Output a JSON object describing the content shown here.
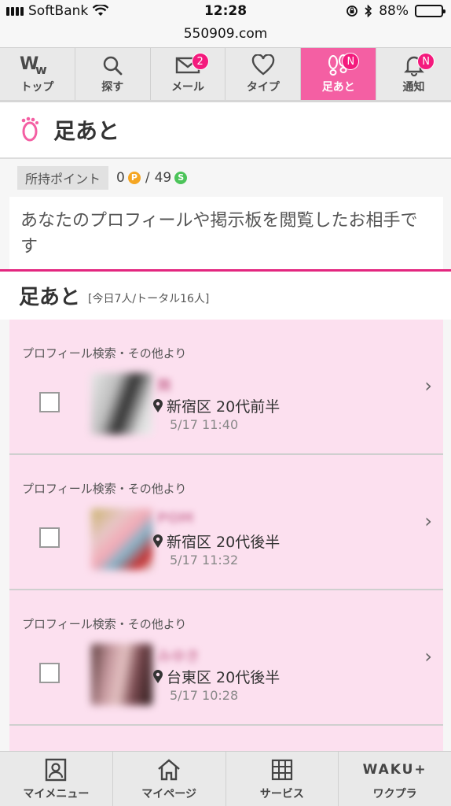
{
  "status_bar": {
    "carrier": "SoftBank",
    "time": "12:28",
    "battery": "88%",
    "battery_level": 0.88
  },
  "browser": {
    "url": "550909.com"
  },
  "nav_tabs": [
    {
      "label": "トップ",
      "icon": "ww-logo-icon",
      "badge": ""
    },
    {
      "label": "探す",
      "icon": "search-icon",
      "badge": ""
    },
    {
      "label": "メール",
      "icon": "mail-icon",
      "badge": "2"
    },
    {
      "label": "タイプ",
      "icon": "heart-icon",
      "badge": ""
    },
    {
      "label": "足あと",
      "icon": "footprint-icon",
      "badge": "N",
      "active": true
    },
    {
      "label": "通知",
      "icon": "bell-icon",
      "badge": "N"
    }
  ],
  "page": {
    "title": "足あと",
    "points_label": "所持ポイント",
    "points_p": "0",
    "points_sep": "/",
    "points_s": "49",
    "description": "あなたのプロフィールや掲示板を閲覧したお相手です"
  },
  "section": {
    "title": "足あと",
    "subtitle": "[今日7人/トータル16人]"
  },
  "visitors": [
    {
      "source": "プロフィール検索・その他より",
      "name": "舞",
      "area": "新宿区 20代前半",
      "datetime": "5/17 11:40"
    },
    {
      "source": "プロフィール検索・その他より",
      "name": "POM",
      "area": "新宿区 20代後半",
      "datetime": "5/17 11:32"
    },
    {
      "source": "プロフィール検索・その他より",
      "name": "みゆき",
      "area": "台東区 20代後半",
      "datetime": "5/17 10:28"
    }
  ],
  "bottom_tabs": [
    {
      "label": "マイメニュー",
      "icon": "person-card-icon"
    },
    {
      "label": "マイページ",
      "icon": "home-icon"
    },
    {
      "label": "サービス",
      "icon": "grid-icon"
    },
    {
      "label": "ワクプラ",
      "icon_text": "WAKU+",
      "icon": "waku-plus-icon"
    }
  ],
  "colors": {
    "accent": "#f45fa3",
    "badge": "#f41a7d",
    "card_bg": "#fce0ef",
    "coin_p": "#f5a623",
    "coin_s": "#4cc45a"
  }
}
